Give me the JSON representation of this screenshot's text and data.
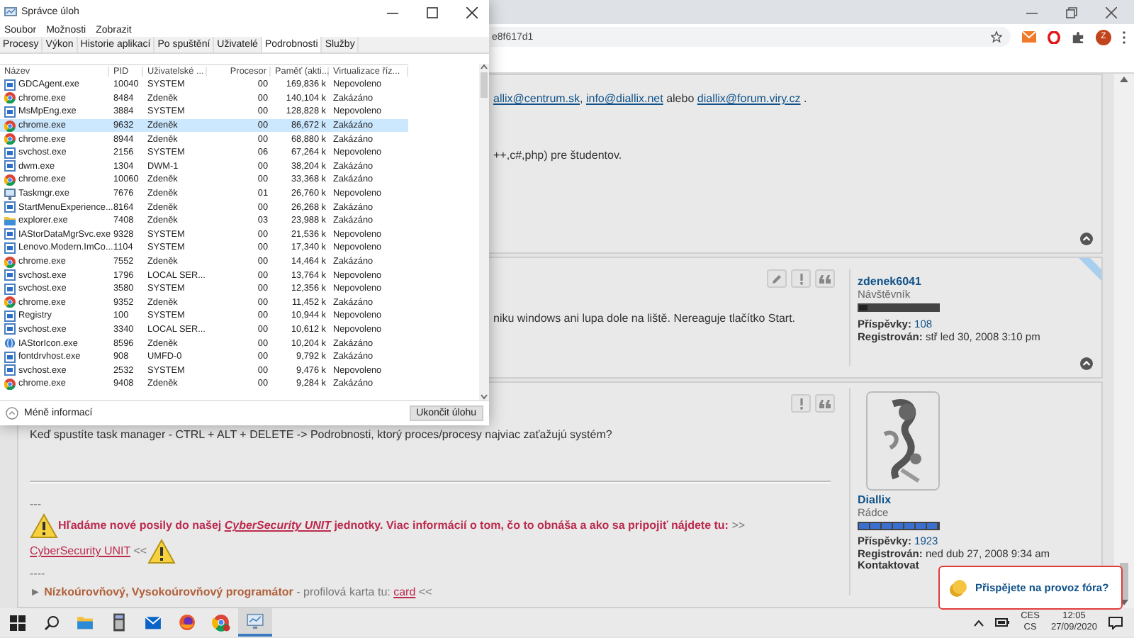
{
  "browser": {
    "address": "e8f617d1",
    "profile_letter": "Z"
  },
  "posts": [
    {
      "lines": [
        {
          "kind": "text",
          "segments": [
            {
              "kind": "link",
              "text": "allix@centrum.sk",
              "after": ", "
            },
            {
              "kind": "link",
              "text": "info@diallix.net",
              "after": " alebo "
            },
            {
              "kind": "link",
              "text": "diallix@forum.viry.cz"
            },
            {
              "kind": "text",
              "text": " ."
            }
          ]
        },
        {
          "kind": "text",
          "segments": [
            {
              "kind": "text",
              "text": "++,c#,php) pre študentov."
            }
          ]
        }
      ]
    },
    {
      "buttons": [
        {
          "kind": "edit"
        },
        {
          "kind": "report"
        },
        {
          "kind": "quote"
        }
      ],
      "online": true,
      "lines": [
        {
          "kind": "text",
          "segments": [
            {
              "kind": "text",
              "text": "niku windows ani lupa dole na liště. Nereaguje tlačítko Start."
            }
          ]
        }
      ],
      "author": {
        "name": "zdenek6041",
        "rank": "Návštěvník",
        "rank_meter": {
          "level": 0.1
        },
        "posts_label": "Příspěvky:",
        "posts": "108",
        "registered_label": "Registrován:",
        "registered": "stř led 30, 2008 3:10 pm"
      }
    },
    {
      "buttons": [
        {
          "kind": "report"
        },
        {
          "kind": "quote"
        }
      ],
      "online": false,
      "lines": [
        {
          "kind": "text",
          "segments": [
            {
              "kind": "text",
              "text": "Keď spustíte task manager - CTRL + ALT + DELETE -> Podrobnosti, ktorý proces/procesy najviac zaťažujú systém?"
            }
          ]
        },
        {
          "kind": "rule"
        },
        {
          "kind": "text",
          "segments": [
            {
              "kind": "grey",
              "text": "---"
            }
          ]
        },
        {
          "kind": "text",
          "segments": [
            {
              "kind": "warning_icon"
            },
            {
              "kind": "alert",
              "text": "Hľadáme nové posily do našej "
            },
            {
              "kind": "alert_link",
              "text": "CyberSecurity UNIT"
            },
            {
              "kind": "alert",
              "text": " jednotky. Viac informácií o tom, čo to obnáša a ako sa pripojiť nájdete tu:"
            },
            {
              "kind": "grey",
              "text": " >>"
            }
          ]
        },
        {
          "kind": "text",
          "segments": [
            {
              "kind": "red_link",
              "text": "CyberSecurity UNIT"
            },
            {
              "kind": "grey",
              "text": " <<"
            },
            {
              "kind": "warning_icon"
            }
          ]
        },
        {
          "kind": "text",
          "segments": [
            {
              "kind": "grey",
              "text": "----"
            }
          ]
        },
        {
          "kind": "text",
          "segments": [
            {
              "kind": "grey",
              "text": "► "
            },
            {
              "kind": "brown",
              "text": "Nízkoúrovňový, Vysokoúrovňový programátor"
            },
            {
              "kind": "grey",
              "text": " - profilová karta tu: "
            },
            {
              "kind": "red_link",
              "text": "card"
            },
            {
              "kind": "grey",
              "text": " <<"
            }
          ]
        }
      ],
      "author": {
        "name": "Diallix",
        "rank": "Rádce",
        "rank_meter": {
          "level": 1
        },
        "posts_label": "Příspěvky:",
        "posts": "1923",
        "registered_label": "Registrován:",
        "registered": "ned dub 27, 2008 9:34 am",
        "contact_label": "Kontaktovat"
      }
    }
  ],
  "donate": "Přispějete na provoz fóra?",
  "task_manager": {
    "title": "Správce úloh",
    "menu": [
      "Soubor",
      "Možnosti",
      "Zobrazit"
    ],
    "tabs": [
      {
        "label": "Procesy",
        "selected": false
      },
      {
        "label": "Výkon",
        "selected": false
      },
      {
        "label": "Historie aplikací",
        "selected": false
      },
      {
        "label": "Po spuštění",
        "selected": false
      },
      {
        "label": "Uživatelé",
        "selected": false
      },
      {
        "label": "Podrobnosti",
        "selected": true
      },
      {
        "label": "Služby",
        "selected": false
      }
    ],
    "columns": [
      "Název",
      "PID",
      "Uživatelské ...",
      "Procesor",
      "Paměť (akti...",
      "Virtualizace říz..."
    ],
    "rows": [
      {
        "kind": "app",
        "name": "GDCAgent.exe",
        "pid": "10040",
        "user": "SYSTEM",
        "cpu": "00",
        "memory": "169,836 k",
        "virt": "Nepovoleno",
        "selected": false
      },
      {
        "kind": "chrome",
        "name": "chrome.exe",
        "pid": "8484",
        "user": "Zdeněk",
        "cpu": "00",
        "memory": "140,104 k",
        "virt": "Zakázáno",
        "selected": false
      },
      {
        "kind": "app",
        "name": "MsMpEng.exe",
        "pid": "3884",
        "user": "SYSTEM",
        "cpu": "00",
        "memory": "128,828 k",
        "virt": "Nepovoleno",
        "selected": false
      },
      {
        "kind": "chrome",
        "name": "chrome.exe",
        "pid": "9632",
        "user": "Zdeněk",
        "cpu": "00",
        "memory": "86,672 k",
        "virt": "Zakázáno",
        "selected": true
      },
      {
        "kind": "chrome",
        "name": "chrome.exe",
        "pid": "8944",
        "user": "Zdeněk",
        "cpu": "00",
        "memory": "68,880 k",
        "virt": "Zakázáno",
        "selected": false
      },
      {
        "kind": "app",
        "name": "svchost.exe",
        "pid": "2156",
        "user": "SYSTEM",
        "cpu": "06",
        "memory": "67,264 k",
        "virt": "Nepovoleno",
        "selected": false
      },
      {
        "kind": "app",
        "name": "dwm.exe",
        "pid": "1304",
        "user": "DWM-1",
        "cpu": "00",
        "memory": "38,204 k",
        "virt": "Zakázáno",
        "selected": false
      },
      {
        "kind": "chrome",
        "name": "chrome.exe",
        "pid": "10060",
        "user": "Zdeněk",
        "cpu": "00",
        "memory": "33,368 k",
        "virt": "Zakázáno",
        "selected": false
      },
      {
        "kind": "monitor",
        "name": "Taskmgr.exe",
        "pid": "7676",
        "user": "Zdeněk",
        "cpu": "01",
        "memory": "26,760 k",
        "virt": "Nepovoleno",
        "selected": false
      },
      {
        "kind": "app",
        "name": "StartMenuExperience...",
        "pid": "8164",
        "user": "Zdeněk",
        "cpu": "00",
        "memory": "26,268 k",
        "virt": "Zakázáno",
        "selected": false
      },
      {
        "kind": "folder",
        "name": "explorer.exe",
        "pid": "7408",
        "user": "Zdeněk",
        "cpu": "03",
        "memory": "23,988 k",
        "virt": "Zakázáno",
        "selected": false
      },
      {
        "kind": "app",
        "name": "IAStorDataMgrSvc.exe",
        "pid": "9328",
        "user": "SYSTEM",
        "cpu": "00",
        "memory": "21,536 k",
        "virt": "Nepovoleno",
        "selected": false
      },
      {
        "kind": "app",
        "name": "Lenovo.Modern.ImCo...",
        "pid": "1104",
        "user": "SYSTEM",
        "cpu": "00",
        "memory": "17,340 k",
        "virt": "Nepovoleno",
        "selected": false
      },
      {
        "kind": "chrome",
        "name": "chrome.exe",
        "pid": "7552",
        "user": "Zdeněk",
        "cpu": "00",
        "memory": "14,464 k",
        "virt": "Zakázáno",
        "selected": false
      },
      {
        "kind": "app",
        "name": "svchost.exe",
        "pid": "1796",
        "user": "LOCAL SER...",
        "cpu": "00",
        "memory": "13,764 k",
        "virt": "Nepovoleno",
        "selected": false
      },
      {
        "kind": "app",
        "name": "svchost.exe",
        "pid": "3580",
        "user": "SYSTEM",
        "cpu": "00",
        "memory": "12,356 k",
        "virt": "Nepovoleno",
        "selected": false
      },
      {
        "kind": "chrome",
        "name": "chrome.exe",
        "pid": "9352",
        "user": "Zdeněk",
        "cpu": "00",
        "memory": "11,452 k",
        "virt": "Zakázáno",
        "selected": false
      },
      {
        "kind": "app",
        "name": "Registry",
        "pid": "100",
        "user": "SYSTEM",
        "cpu": "00",
        "memory": "10,944 k",
        "virt": "Nepovoleno",
        "selected": false
      },
      {
        "kind": "app",
        "name": "svchost.exe",
        "pid": "3340",
        "user": "LOCAL SER...",
        "cpu": "00",
        "memory": "10,612 k",
        "virt": "Nepovoleno",
        "selected": false
      },
      {
        "kind": "globe",
        "name": "IAStorIcon.exe",
        "pid": "8596",
        "user": "Zdeněk",
        "cpu": "00",
        "memory": "10,204 k",
        "virt": "Zakázáno",
        "selected": false
      },
      {
        "kind": "app",
        "name": "fontdrvhost.exe",
        "pid": "908",
        "user": "UMFD-0",
        "cpu": "00",
        "memory": "9,792 k",
        "virt": "Zakázáno",
        "selected": false
      },
      {
        "kind": "app",
        "name": "svchost.exe",
        "pid": "2532",
        "user": "SYSTEM",
        "cpu": "00",
        "memory": "9,476 k",
        "virt": "Nepovoleno",
        "selected": false
      },
      {
        "kind": "chrome",
        "name": "chrome.exe",
        "pid": "9408",
        "user": "Zdeněk",
        "cpu": "00",
        "memory": "9,284 k",
        "virt": "Zakázáno",
        "selected": false
      }
    ],
    "less_info": "Méně informací",
    "end_task": "Ukončit úlohu"
  },
  "taskbar": {
    "apps": [
      {
        "kind": "explorer",
        "selected": false
      },
      {
        "kind": "calculator",
        "selected": false
      },
      {
        "kind": "mail",
        "selected": false
      },
      {
        "kind": "firefox",
        "selected": false
      },
      {
        "kind": "chrome",
        "selected": false
      },
      {
        "kind": "taskmgr",
        "selected": true
      }
    ],
    "lang": "CES",
    "layout": "CS",
    "time": "12:05",
    "date": "27/09/2020"
  }
}
